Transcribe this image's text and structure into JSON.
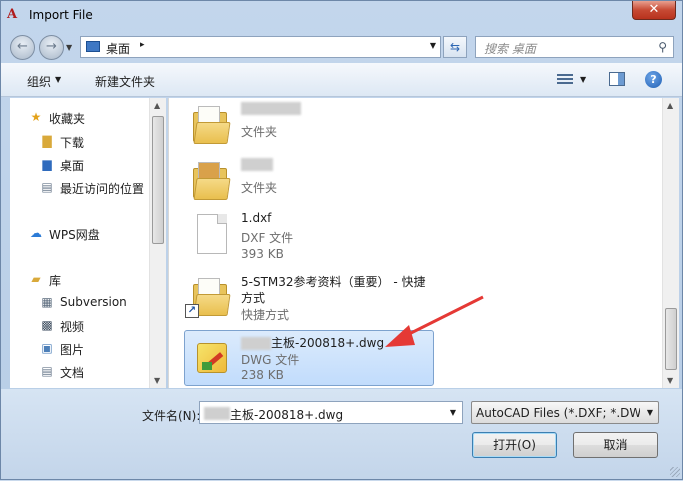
{
  "window": {
    "title": "Import File",
    "close_symbol": "✕"
  },
  "address": {
    "path_label": "桌面",
    "path_separator": "▸",
    "search_placeholder": "搜索 桌面"
  },
  "toolbar": {
    "organize_label": "组织",
    "new_folder_label": "新建文件夹",
    "help_symbol": "?"
  },
  "nav": {
    "items": [
      {
        "label": "收藏夹",
        "icon": "star-icon"
      },
      {
        "label": "下载",
        "icon": "download-folder-icon"
      },
      {
        "label": "桌面",
        "icon": "desktop-icon"
      },
      {
        "label": "最近访问的位置",
        "icon": "recent-places-icon"
      },
      {
        "label": "WPS网盘",
        "icon": "cloud-icon"
      },
      {
        "label": "库",
        "icon": "library-icon"
      },
      {
        "label": "Subversion",
        "icon": "subversion-icon"
      },
      {
        "label": "视频",
        "icon": "video-icon"
      },
      {
        "label": "图片",
        "icon": "pictures-icon"
      },
      {
        "label": "文档",
        "icon": "documents-icon"
      }
    ]
  },
  "files": [
    {
      "name": "",
      "type": "文件夹",
      "size": ""
    },
    {
      "name": "",
      "type": "文件夹",
      "size": ""
    },
    {
      "name": "1.dxf",
      "type": "DXF 文件",
      "size": "393 KB"
    },
    {
      "name": "5-STM32参考资料（重要） - 快捷",
      "name_line2": "方式",
      "type": "快捷方式",
      "size": ""
    },
    {
      "name": "主板-200818+.dwg",
      "type": "DWG 文件",
      "size": "238 KB",
      "selected": true
    }
  ],
  "bottom": {
    "file_name_label": "文件名(N):",
    "file_name_value": "主板-200818+.dwg",
    "filter_value": "AutoCAD Files (*.DXF; *.DWG",
    "open_label": "打开(O)",
    "cancel_label": "取消"
  },
  "colors": {
    "annotation_arrow": "#e53935",
    "selection": "#c1dcfc"
  }
}
